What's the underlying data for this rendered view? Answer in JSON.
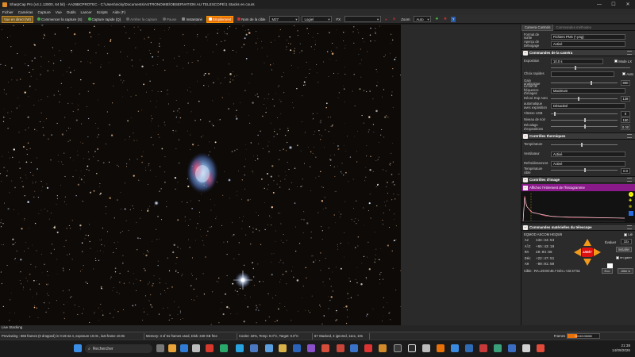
{
  "window": {
    "title": "SharpCap Pro (v4.1.13000, 64 bit) - AA26BCPROTEC - C:\\Users\\nicky\\Documents\\ASTRONOMIE\\OBSERVATION AU TELESCOPE\\1 Stacks en cours",
    "minimize": "—",
    "maximize": "☐",
    "close": "✕"
  },
  "menu": [
    "Fichier",
    "Caméras",
    "Capture",
    "Vue",
    "Outils",
    "Lancer",
    "Scripts",
    "Aide (F)"
  ],
  "toolbar": {
    "live_view": "Vue en direct (W)",
    "start_capture": "Commencer la capture (S)",
    "quick_capture": "Capture rapide (Q)",
    "stop_capture": "Arrêter la capture",
    "pause": "Pause",
    "snapshot": "Instantané",
    "live_stack": "Empilement",
    "target_label": "Nom de la cible",
    "target_value": "M27",
    "stretch_value": "Logiel",
    "fx_label": "FX",
    "fx_value": "",
    "zoom_label": "Zoom",
    "zoom_value": "Auto"
  },
  "panel": {
    "tabs": [
      "Camera Controls",
      "Commandes méthodes"
    ],
    "capture": {
      "format_label": "Format de sortie",
      "format_value": "Fichiers PNG (*.png)",
      "preview_label": "Aperçu de Débogage",
      "preview_value": "Activé"
    },
    "camera_section": "Commandes de la caméra",
    "camera": {
      "exposure_label": "Exposition",
      "exposure_value": "10.0 s",
      "lx_mode": "Mode LX",
      "quick_label": "Choix rapides",
      "auto": "Auto",
      "gain_label": "Gain analogique",
      "gain_value": "800",
      "lock_label": "Limite de fréquence d'images",
      "lock_value": "Maximum",
      "offset_label": "Décal. Exp Auto",
      "offset_value": "128",
      "autoexp_label": "automatique avec exposition",
      "autoexp_value": "Désactivé",
      "usb_label": "Vitesse USB",
      "usb_value": "0",
      "black_label": "Niveau de noir",
      "black_value": "150",
      "shift_label": "Décalage d'expositions",
      "shift_value": "0.00"
    },
    "thermal_section": "Contrôles thermiques",
    "thermal": {
      "temp_label": "Température",
      "fan_label": "Ventilateur",
      "fan_value": "Activé",
      "cooling_label": "Refroidissement",
      "cooling_value": "Activé",
      "target_label": "Température cible",
      "target_value": "0.0"
    },
    "image_section": "Contrôles d'image",
    "histogram_title": "Affichez l'étirement de l'histogramme",
    "telescope_section": "Commandes matérielles du télescope",
    "telescope": {
      "device": "EQMOD ASCOM HEQ5/6",
      "lock": "Lié",
      "az_label": "Az",
      "az_value": "134:34:53",
      "alt_label": "Alt",
      "alt_value": "+65:43:19",
      "ra_label": "RA",
      "ra_value": "20:03:56",
      "dec_label": "Déc",
      "dec_value": "+22:47:51",
      "ah_label": "AH",
      "ah_value": "-00:01:50",
      "speed_label": "Évaluer",
      "speed_value": "32x",
      "install": "Installer",
      "stop": "ARRÊT",
      "park_label": "en garer",
      "coords": "Cible : RA=20:00:46.7 Déc=+22:47:51",
      "goto_btn": "Eco",
      "stop_btn": "Aller à"
    }
  },
  "status": {
    "live_stacking": "Live Stacking",
    "previewing": "Previewing : 666 frames (0 dropped) in 0:19:42.4, exposure 10.0s , last frame 10.0s",
    "memory": "Memory: 3 of 51 frames used, Disk: 340 GB free",
    "cooler": "Cooler: 32%, Temp: 0.0°C, Target: 0.0°C",
    "stacked": "67 Stacked, 4 ignored, 11ex, 10s",
    "frames_label": "Frames",
    "elapsed": "00:02:00/08"
  },
  "taskbar": {
    "search": "Rechercher",
    "time": "21:38",
    "date": "14/09/2026"
  }
}
